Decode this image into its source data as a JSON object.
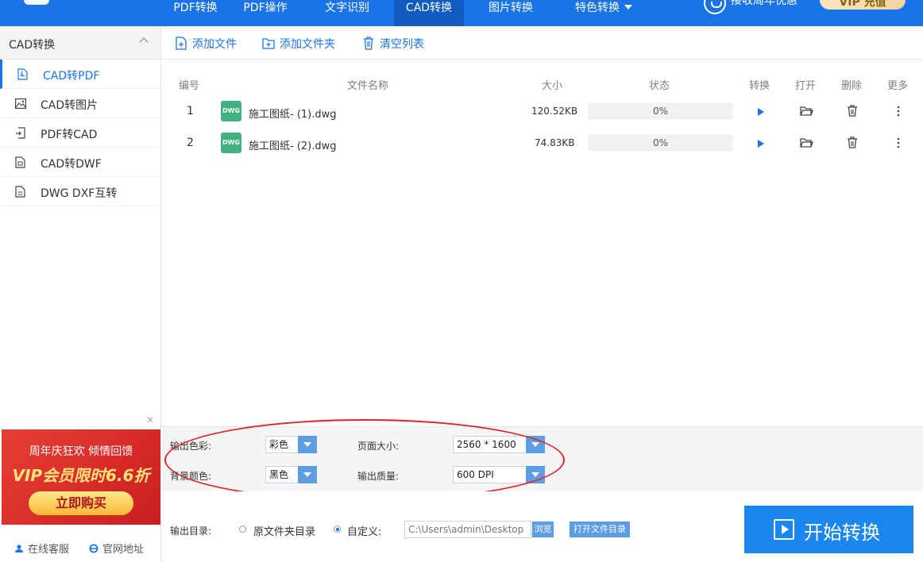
{
  "nav": {
    "tabs": [
      {
        "label": "PDF转换"
      },
      {
        "label": "PDF操作"
      },
      {
        "label": "文字识别"
      },
      {
        "label": "CAD转换"
      },
      {
        "label": "图片转换"
      },
      {
        "label": "特色转换"
      }
    ],
    "active_tab": "CAD转换",
    "user_text": "接收周年优惠",
    "vip_label": "VIP  充值"
  },
  "sidebar": {
    "section_title": "CAD转换",
    "items": [
      {
        "label": "CAD转PDF",
        "icon": "pdf-file-icon"
      },
      {
        "label": "CAD转图片",
        "icon": "image-icon"
      },
      {
        "label": "PDF转CAD",
        "icon": "file-import-icon"
      },
      {
        "label": "CAD转DWF",
        "icon": "file-icon"
      },
      {
        "label": "DWG DXF互转",
        "icon": "file-lines-icon"
      }
    ],
    "ad": {
      "line1": "周年庆狂欢 倾情回馈",
      "line2": "VIP会员限时6.6折",
      "button": "立即购买"
    },
    "footer": {
      "support": "在线客服",
      "website": "官网地址"
    }
  },
  "toolbar": {
    "add_file": "添加文件",
    "add_folder": "添加文件夹",
    "clear_list": "清空列表"
  },
  "table": {
    "headers": {
      "index": "编号",
      "name": "文件名称",
      "size": "大小",
      "status": "状态",
      "convert": "转换",
      "open": "打开",
      "delete": "删除",
      "more": "更多"
    },
    "rows": [
      {
        "index": "1",
        "badge": "DWG",
        "name": "施工图纸- (1).dwg",
        "size": "120.52KB",
        "status": "0%"
      },
      {
        "index": "2",
        "badge": "DWG",
        "name": "施工图纸- (2).dwg",
        "size": "74.83KB",
        "status": "0%"
      }
    ]
  },
  "settings": {
    "output_color_label": "输出色彩:",
    "output_color_value": "彩色",
    "background_label": "背景颜色:",
    "background_value": "黑色",
    "page_size_label": "页面大小:",
    "page_size_value": "2560 * 1600",
    "quality_label": "输出质量:",
    "quality_value": "600 DPI"
  },
  "output": {
    "dir_label": "输出目录:",
    "option_original": "原文件夹目录",
    "option_custom": "自定义:",
    "selected": "custom",
    "path": "C:\\Users\\admin\\Desktop",
    "browse": "浏览",
    "open_folder": "打开文件目录",
    "start": "开始转换"
  },
  "colors": {
    "primary": "#1a74e5",
    "badge_green": "#3fb27f",
    "highlight_red": "#e3222a"
  }
}
